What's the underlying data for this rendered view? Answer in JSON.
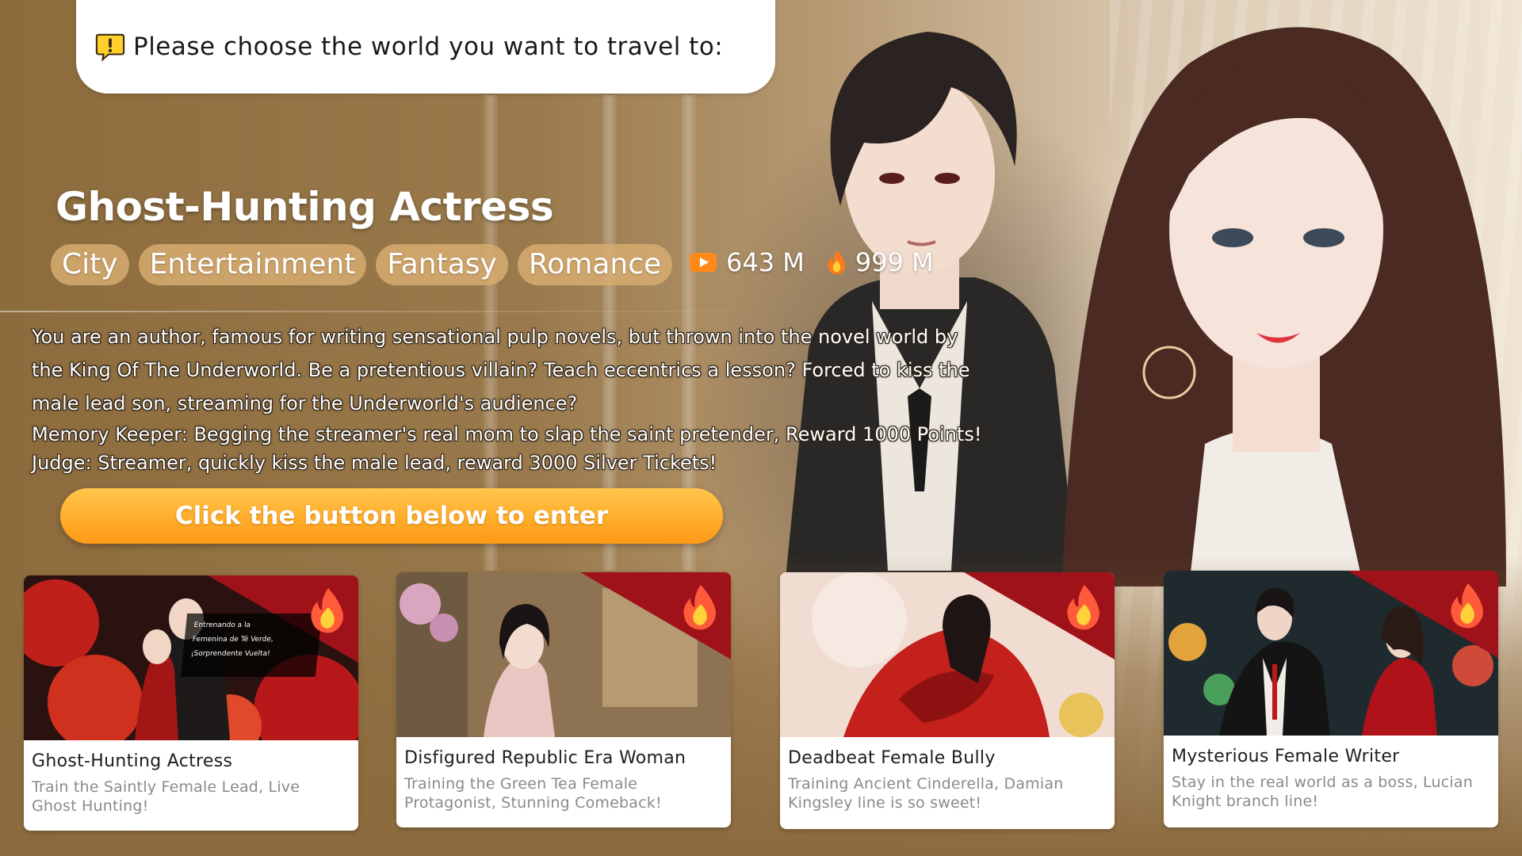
{
  "prompt": {
    "icon": "exclamation-speech-icon",
    "text": "Please choose the world you want to travel to:"
  },
  "world": {
    "title": "Ghost-Hunting Actress",
    "tags": [
      "City",
      "Entertainment",
      "Fantasy",
      "Romance"
    ],
    "views": "643 M",
    "heat": "999 M",
    "description": [
      "You are an author, famous for writing sensational pulp novels, but thrown into the novel world by",
      "the King Of The Underworld. Be a pretentious villain? Teach eccentrics a lesson? Forced to kiss the",
      "male lead son, streaming for the Underworld's audience?"
    ],
    "extra": [
      "Memory Keeper: Begging the streamer's real mom to slap the saint pretender, Reward 1000 Points!",
      "Judge: Streamer, quickly kiss the male lead, reward 3000 Silver Tickets!"
    ]
  },
  "enter_button": "Click the button below to enter",
  "cards": [
    {
      "title": "Ghost-Hunting Actress",
      "subtitle_lines": [
        "Train the Saintly Female Lead, Live",
        "Ghost Hunting!"
      ],
      "thumb_caption": [
        "Entrenando a la",
        "Femenina de Té Verde,",
        "¡Sorprendente Vuelta!"
      ],
      "hot_icon": "fire-icon"
    },
    {
      "title": "Disfigured Republic Era Woman",
      "subtitle_lines": [
        "Training the Green Tea Female",
        "Protagonist, Stunning Comeback!"
      ],
      "hot_icon": "fire-icon"
    },
    {
      "title": "Deadbeat Female Bully",
      "subtitle_lines": [
        "Training Ancient Cinderella, Damian",
        "Kingsley line is so sweet!"
      ],
      "hot_icon": "fire-icon"
    },
    {
      "title": "Mysterious Female Writer",
      "subtitle_lines": [
        "Stay in the real world as a boss, Lucian",
        "Knight branch line!"
      ],
      "hot_icon": "fire-icon"
    }
  ],
  "colors": {
    "accent_orange": "#ffad2a",
    "tag_bg": "#d6ac70",
    "hot_red": "#a0121a",
    "bg_brown": "#8a6a3e"
  }
}
